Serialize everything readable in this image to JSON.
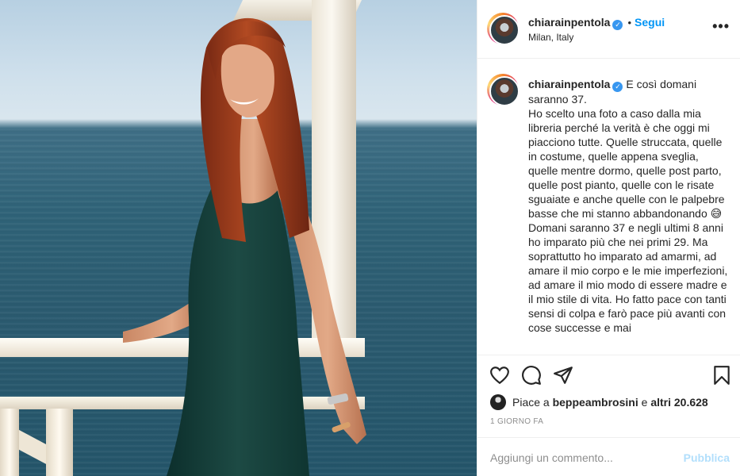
{
  "post": {
    "username": "chiarainpentola",
    "verified_icon": "verified-badge-icon",
    "follow_label": "Segui",
    "separator": "•",
    "location": "Milan, Italy",
    "more_label": "•••",
    "caption_text": " E così domani saranno 37.\nHo scelto una foto a caso dalla mia libreria perché la verità è che oggi mi piacciono tutte. Quelle struccata, quelle in costume, quelle appena sveglia, quelle mentre dormo, quelle post parto, quelle post pianto, quelle con le risate sguaiate e anche quelle con le palpebre basse che mi stanno abbandonando 😅 Domani saranno 37 e negli ultimi 8 anni ho imparato più che nei primi 29. Ma soprattutto ho imparato ad amarmi, ad amare il mio corpo e le mie imperfezioni, ad amare il mio modo di essere madre e il mio stile di vita. Ho fatto pace con tanti sensi di colpa e farò pace più avanti con cose successe e mai",
    "likes": {
      "prefix": "Piace a ",
      "liker": "beppeambrosini",
      "middle": " e ",
      "others": "altri 20.628"
    },
    "timestamp": "1 GIORNO FA",
    "comment": {
      "placeholder": "Aggiungi un commento...",
      "value": "",
      "publish_label": "Pubblica"
    },
    "icons": {
      "like": "heart-icon",
      "comment": "comment-icon",
      "share": "share-icon",
      "save": "bookmark-icon"
    },
    "colors": {
      "accent": "#0095f6",
      "publish_disabled": "#b2dffc",
      "verified": "#3897f0",
      "muted": "#8e8e8e"
    }
  }
}
